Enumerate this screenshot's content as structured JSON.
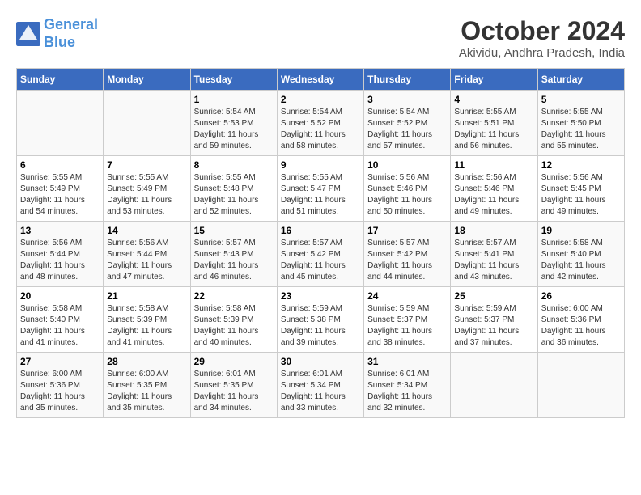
{
  "header": {
    "logo_line1": "General",
    "logo_line2": "Blue",
    "month": "October 2024",
    "location": "Akividu, Andhra Pradesh, India"
  },
  "weekdays": [
    "Sunday",
    "Monday",
    "Tuesday",
    "Wednesday",
    "Thursday",
    "Friday",
    "Saturday"
  ],
  "weeks": [
    [
      {
        "day": "",
        "info": ""
      },
      {
        "day": "",
        "info": ""
      },
      {
        "day": "1",
        "info": "Sunrise: 5:54 AM\nSunset: 5:53 PM\nDaylight: 11 hours and 59 minutes."
      },
      {
        "day": "2",
        "info": "Sunrise: 5:54 AM\nSunset: 5:52 PM\nDaylight: 11 hours and 58 minutes."
      },
      {
        "day": "3",
        "info": "Sunrise: 5:54 AM\nSunset: 5:52 PM\nDaylight: 11 hours and 57 minutes."
      },
      {
        "day": "4",
        "info": "Sunrise: 5:55 AM\nSunset: 5:51 PM\nDaylight: 11 hours and 56 minutes."
      },
      {
        "day": "5",
        "info": "Sunrise: 5:55 AM\nSunset: 5:50 PM\nDaylight: 11 hours and 55 minutes."
      }
    ],
    [
      {
        "day": "6",
        "info": "Sunrise: 5:55 AM\nSunset: 5:49 PM\nDaylight: 11 hours and 54 minutes."
      },
      {
        "day": "7",
        "info": "Sunrise: 5:55 AM\nSunset: 5:49 PM\nDaylight: 11 hours and 53 minutes."
      },
      {
        "day": "8",
        "info": "Sunrise: 5:55 AM\nSunset: 5:48 PM\nDaylight: 11 hours and 52 minutes."
      },
      {
        "day": "9",
        "info": "Sunrise: 5:55 AM\nSunset: 5:47 PM\nDaylight: 11 hours and 51 minutes."
      },
      {
        "day": "10",
        "info": "Sunrise: 5:56 AM\nSunset: 5:46 PM\nDaylight: 11 hours and 50 minutes."
      },
      {
        "day": "11",
        "info": "Sunrise: 5:56 AM\nSunset: 5:46 PM\nDaylight: 11 hours and 49 minutes."
      },
      {
        "day": "12",
        "info": "Sunrise: 5:56 AM\nSunset: 5:45 PM\nDaylight: 11 hours and 49 minutes."
      }
    ],
    [
      {
        "day": "13",
        "info": "Sunrise: 5:56 AM\nSunset: 5:44 PM\nDaylight: 11 hours and 48 minutes."
      },
      {
        "day": "14",
        "info": "Sunrise: 5:56 AM\nSunset: 5:44 PM\nDaylight: 11 hours and 47 minutes."
      },
      {
        "day": "15",
        "info": "Sunrise: 5:57 AM\nSunset: 5:43 PM\nDaylight: 11 hours and 46 minutes."
      },
      {
        "day": "16",
        "info": "Sunrise: 5:57 AM\nSunset: 5:42 PM\nDaylight: 11 hours and 45 minutes."
      },
      {
        "day": "17",
        "info": "Sunrise: 5:57 AM\nSunset: 5:42 PM\nDaylight: 11 hours and 44 minutes."
      },
      {
        "day": "18",
        "info": "Sunrise: 5:57 AM\nSunset: 5:41 PM\nDaylight: 11 hours and 43 minutes."
      },
      {
        "day": "19",
        "info": "Sunrise: 5:58 AM\nSunset: 5:40 PM\nDaylight: 11 hours and 42 minutes."
      }
    ],
    [
      {
        "day": "20",
        "info": "Sunrise: 5:58 AM\nSunset: 5:40 PM\nDaylight: 11 hours and 41 minutes."
      },
      {
        "day": "21",
        "info": "Sunrise: 5:58 AM\nSunset: 5:39 PM\nDaylight: 11 hours and 41 minutes."
      },
      {
        "day": "22",
        "info": "Sunrise: 5:58 AM\nSunset: 5:39 PM\nDaylight: 11 hours and 40 minutes."
      },
      {
        "day": "23",
        "info": "Sunrise: 5:59 AM\nSunset: 5:38 PM\nDaylight: 11 hours and 39 minutes."
      },
      {
        "day": "24",
        "info": "Sunrise: 5:59 AM\nSunset: 5:37 PM\nDaylight: 11 hours and 38 minutes."
      },
      {
        "day": "25",
        "info": "Sunrise: 5:59 AM\nSunset: 5:37 PM\nDaylight: 11 hours and 37 minutes."
      },
      {
        "day": "26",
        "info": "Sunrise: 6:00 AM\nSunset: 5:36 PM\nDaylight: 11 hours and 36 minutes."
      }
    ],
    [
      {
        "day": "27",
        "info": "Sunrise: 6:00 AM\nSunset: 5:36 PM\nDaylight: 11 hours and 35 minutes."
      },
      {
        "day": "28",
        "info": "Sunrise: 6:00 AM\nSunset: 5:35 PM\nDaylight: 11 hours and 35 minutes."
      },
      {
        "day": "29",
        "info": "Sunrise: 6:01 AM\nSunset: 5:35 PM\nDaylight: 11 hours and 34 minutes."
      },
      {
        "day": "30",
        "info": "Sunrise: 6:01 AM\nSunset: 5:34 PM\nDaylight: 11 hours and 33 minutes."
      },
      {
        "day": "31",
        "info": "Sunrise: 6:01 AM\nSunset: 5:34 PM\nDaylight: 11 hours and 32 minutes."
      },
      {
        "day": "",
        "info": ""
      },
      {
        "day": "",
        "info": ""
      }
    ]
  ]
}
